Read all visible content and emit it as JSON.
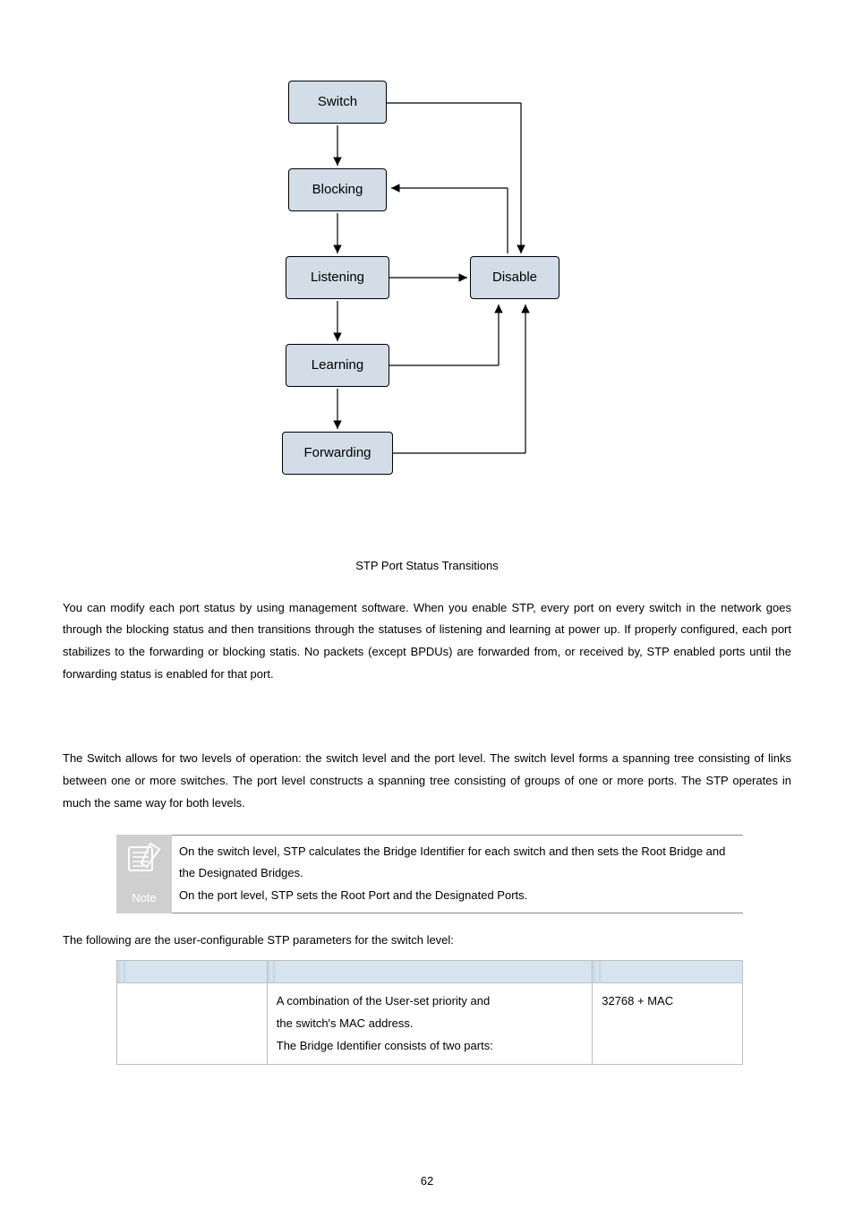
{
  "diagram": {
    "nodes": {
      "switch": "Switch",
      "blocking": "Blocking",
      "listening": "Listening",
      "disable": "Disable",
      "learning": "Learning",
      "forwarding": "Forwarding"
    },
    "caption": "STP Port Status Transitions"
  },
  "paragraphs": {
    "p1": "You can modify each port status by using management software. When you enable STP, every port on every switch in the network goes through the blocking status and then transitions through the statuses of listening and learning at power up. If properly configured, each port stabilizes to the forwarding or blocking statis. No packets (except BPDUs) are forwarded from, or received by, STP enabled ports until the forwarding status is enabled for that port.",
    "p2": "The Switch allows for two levels of operation: the switch level and the port level. The switch level forms a spanning tree consisting of links between one or more switches. The port level constructs a spanning tree consisting of groups of one or more ports. The STP operates in much the same way for both levels.",
    "note_line1": "On the switch level, STP calculates the Bridge Identifier for each switch and then sets the Root Bridge and the Designated Bridges.",
    "note_line2": "On the port level, STP sets the Root Port and the Designated Ports.",
    "p3": "The following are the user-configurable STP parameters for the switch level:"
  },
  "note_label": "Note",
  "table": {
    "row1": {
      "param": "",
      "desc_l1": "A combination of the User-set priority and",
      "desc_l2": "the switch's MAC address.",
      "desc_l3": "The Bridge Identifier consists of two parts:",
      "default": "32768 + MAC"
    }
  },
  "page_number": "62"
}
